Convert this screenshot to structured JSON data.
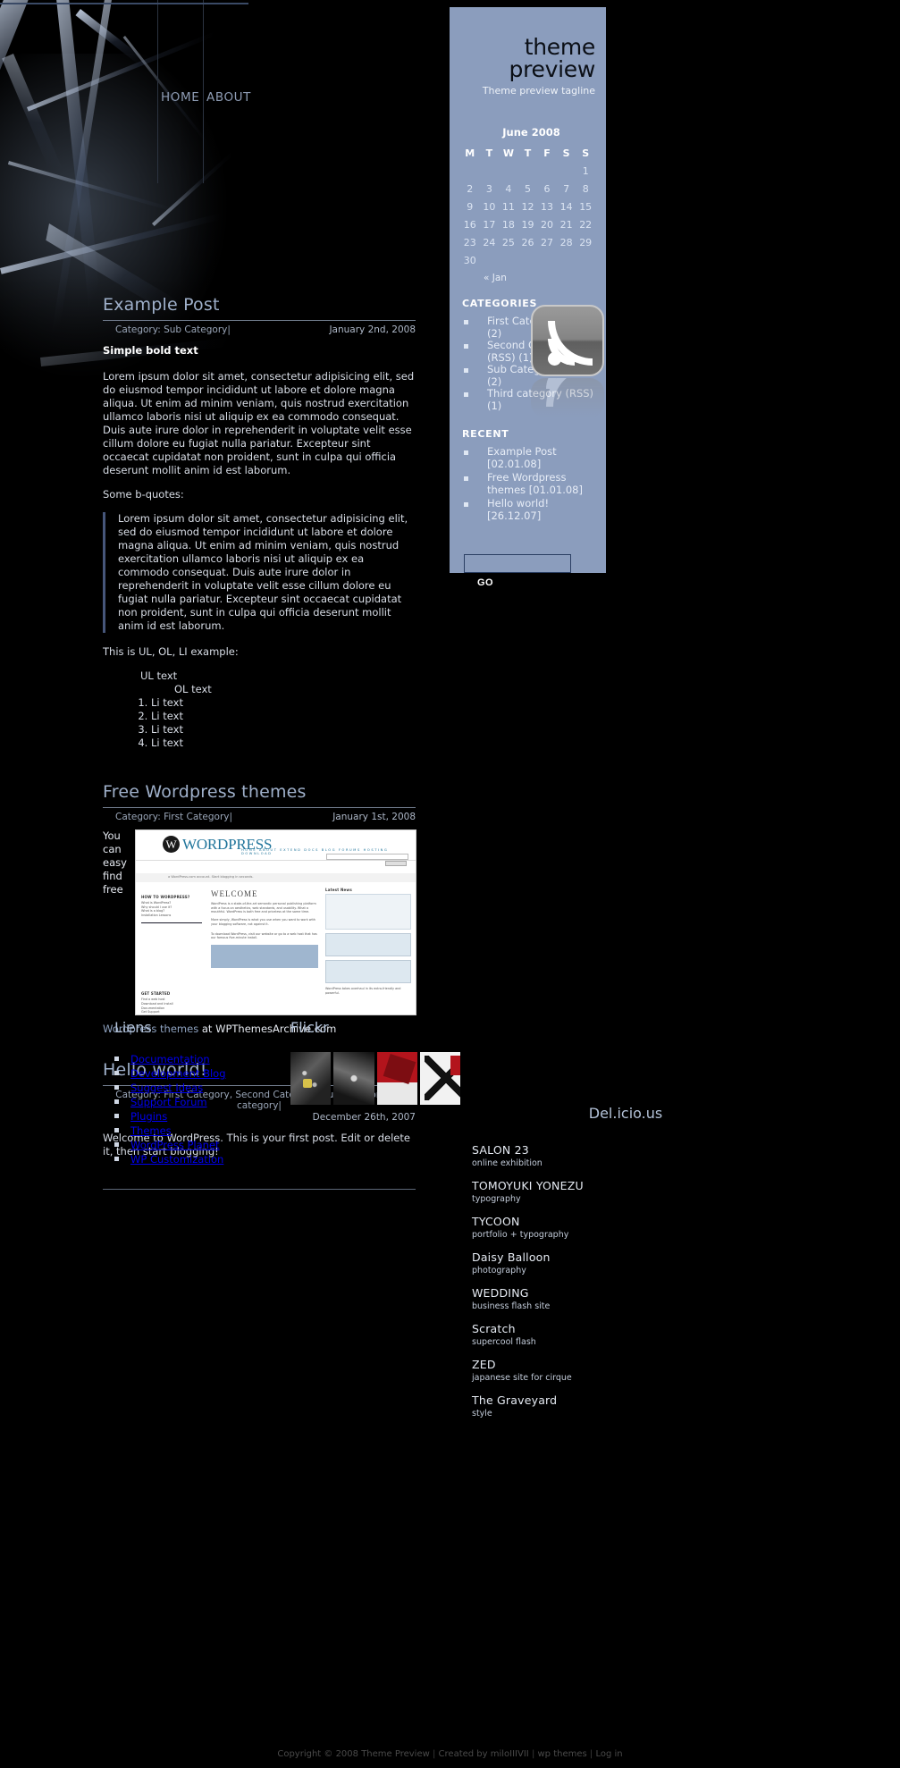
{
  "site": {
    "title": "theme preview",
    "tagline": "Theme preview tagline"
  },
  "nav": {
    "home": "HOME",
    "about": "ABOUT"
  },
  "sidebar": {
    "calendar": {
      "caption": "June 2008",
      "weekdays": [
        "M",
        "T",
        "W",
        "T",
        "F",
        "S",
        "S"
      ],
      "weeks": [
        [
          "",
          "",
          "",
          "",
          "",
          "",
          "1"
        ],
        [
          "2",
          "3",
          "4",
          "5",
          "6",
          "7",
          "8"
        ],
        [
          "9",
          "10",
          "11",
          "12",
          "13",
          "14",
          "15"
        ],
        [
          "16",
          "17",
          "18",
          "19",
          "20",
          "21",
          "22"
        ],
        [
          "23",
          "24",
          "25",
          "26",
          "27",
          "28",
          "29"
        ],
        [
          "30",
          "",
          "",
          "",
          "",
          "",
          ""
        ]
      ],
      "prev": "« Jan"
    },
    "categories_title": "CATEGORIES",
    "categories": [
      "First Category (RSS) (2)",
      "Second Category (RSS) (1)",
      "Sub Category (RSS) (2)",
      "Third category (RSS) (1)"
    ],
    "recent_title": "RECENT",
    "recent": [
      "Example Post [02.01.08]",
      "Free Wordpress themes [01.01.08]",
      "Hello world! [26.12.07]"
    ],
    "search": {
      "value": "",
      "placeholder": "",
      "button": "GO"
    },
    "rss_icon": "rss-feed-icon"
  },
  "posts": [
    {
      "title": "Example Post",
      "categories": "Category: Sub Category",
      "date": "January 2nd, 2008",
      "bold_line": "Simple bold text",
      "paragraph": "Lorem ipsum dolor sit amet, consectetur adipisicing elit, sed do eiusmod tempor incididunt ut labore et dolore magna aliqua. Ut enim ad minim veniam, quis nostrud exercitation ullamco laboris nisi ut aliquip ex ea commodo consequat. Duis aute irure dolor in reprehenderit in voluptate velit esse cillum dolore eu fugiat nulla pariatur. Excepteur sint occaecat cupidatat non proident, sunt in culpa qui officia deserunt mollit anim id est laborum.",
      "quote_intro": "Some b-quotes:",
      "quote": "Lorem ipsum dolor sit amet, consectetur adipisicing elit, sed do eiusmod tempor incididunt ut labore et dolore magna aliqua. Ut enim ad minim veniam, quis nostrud exercitation ullamco laboris nisi ut aliquip ex ea commodo consequat. Duis aute irure dolor in reprehenderit in voluptate velit esse cillum dolore eu fugiat nulla pariatur. Excepteur sint occaecat cupidatat non proident, sunt in culpa qui officia deserunt mollit anim id est laborum.",
      "list_intro": "This is UL, OL, LI example:",
      "ul_text": "UL text",
      "ol_text": "OL text",
      "li_items": [
        "Li text",
        "Li text",
        "Li text",
        "Li text"
      ]
    },
    {
      "title": "Free Wordpress themes",
      "categories": "Category: First Category",
      "date": "January 1st, 2008",
      "float_text": "You can easy find free",
      "caption_link": "Wordpress themes",
      "caption_rest": " at WPThemesArchive.com"
    },
    {
      "title": "Hello world!",
      "categories": "Category: First Category, Second Category, Sub Category, Third category",
      "date": "December 26th, 2007",
      "paragraph": "Welcome to WordPress. This is your first post. Edit or delete it, then start blogging!"
    }
  ],
  "wp_screenshot": {
    "logo": "WORDPRESS",
    "menu": "HOME   ABOUT   EXTEND   DOCS   BLOG   FORUMS   HOSTING   DOWNLOAD",
    "search_button": "Search",
    "banner": "a WordPress.com account. Start blogging in seconds.",
    "col_left_head": "HOW TO WORDPRESS?",
    "col_left_items": "What is WordPress?\nWhy should I use it?\nWhat is a blog?\nInstallation Lessons",
    "col_mid_head": "WELCOME",
    "col_mid_title": "WordPress",
    "col_mid_text": "WordPress is a state-of-the-art semantic personal publishing platform with a focus on aesthetics, web standards, and usability. What a mouthful. WordPress is both free and priceless at the same time.\n\nMore simply, WordPress is what you use when you want to work with your blogging software, not against it.",
    "col_mid_footer": "To download WordPress, visit our website or go to a web host that has our famous five-minute install.",
    "col_right_head": "Latest News",
    "col_right_foot": "WordPress takes overhaul in its extra-friendly and powerful.",
    "get_started_head": "GET STARTED",
    "get_started_items": "Find a web host\nDownload and Install\nDocumentation\nGet Support"
  },
  "footer": {
    "liens_title": "Liens",
    "liens": [
      "Documentation",
      "Development Blog",
      "Suggest Ideas",
      "Support Forum",
      "Plugins",
      "Themes",
      "WordPress Planet",
      "WP Customization"
    ],
    "flickr_title": "Flickr",
    "delicious_title": "Del.icio.us",
    "delicious": [
      {
        "title": "SALON 23",
        "desc": "online exhibition"
      },
      {
        "title": "TOMOYUKI YONEZU",
        "desc": "typography"
      },
      {
        "title": "TYCOON",
        "desc": "portfolio + typography"
      },
      {
        "title": "Daisy Balloon",
        "desc": "photography"
      },
      {
        "title": "WEDDING",
        "desc": "business flash site"
      },
      {
        "title": "Scratch",
        "desc": "supercool flash"
      },
      {
        "title": "ZED",
        "desc": "japanese site for cirque"
      },
      {
        "title": "The Graveyard",
        "desc": "style"
      }
    ],
    "copyright": "Copyright © 2008 Theme Preview",
    "created_by": "Created by miloIIIVII",
    "wp_themes": "wp themes",
    "login": "Log in"
  },
  "colors": {
    "sidebar_bg": "#8b9dbd",
    "heading": "#9fb0ca",
    "body_text": "#d8dde6"
  }
}
